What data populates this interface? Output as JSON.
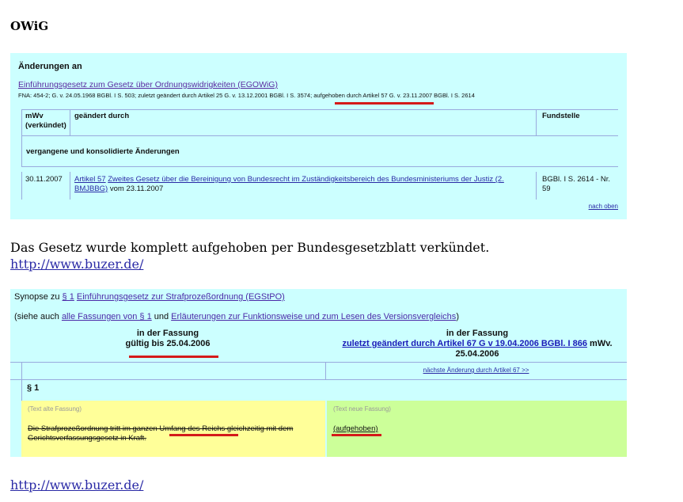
{
  "heading": "OWiG",
  "panel1": {
    "header": "Änderungen an",
    "law_link": "Einführungsgesetz zum Gesetz über Ordnungswidrigkeiten (EGOWiG)",
    "fna_part1": "FNA: 454-2; G. v. 24.05.1968 BGBl. I S. 503; zuletzt geändert durch Artikel 25 G. v. 13.12.2001 BGBl. I S. 3574; ",
    "fna_part2": "aufgehoben durch Artikel 57 G. v. 23.11.2007 BGBl. I S. 2614",
    "col_mwv_1": "mWv",
    "col_mwv_2": "(verkündet)",
    "col_changed_by": "geändert durch",
    "col_fundstelle": "Fundstelle",
    "section": "vergangene und konsolidierte Änderungen",
    "row": {
      "date": "30.11.2007",
      "article": "Artikel 57",
      "law_title_1": "Zweites Gesetz über die Bereinigung von Bundesrecht im Zuständigkeitsbereich des Bundesministeriums der Justiz (2.",
      "law_title_2": "BMJBBG)",
      "law_date": " vom 23.11.2007",
      "fundstelle_1": "BGBl. I S. 2614 - Nr.",
      "fundstelle_2": "59"
    },
    "nach_oben": "nach oben"
  },
  "paragraph": "Das Gesetz wurde komplett aufgehoben per Bundesgesetzblatt verkündet.",
  "url1": "http://www.buzer.de/",
  "panel2": {
    "synopse_prefix": "Synopse zu ",
    "synopse_section": "§ 1",
    "synopse_law": "Einführungsgesetz zur Strafprozeßordnung (EGStPO)",
    "siehe_prefix": "(siehe auch ",
    "siehe_link1": "alle Fassungen von § 1",
    "siehe_mid": " und ",
    "siehe_link2": "Erläuterungen zur Funktionsweise und zum Lesen des Versionsvergleichs",
    "siehe_suffix": ")",
    "left_line1": "in der Fassung",
    "left_line2": "gültig bis 25.04.2006",
    "right_line1": "in der Fassung",
    "right_link": "zuletzt geändert durch Artikel 67 G v 19.04.2006 BGBl. I 866",
    "right_suffix": " mWv.",
    "right_line3": "25.04.2006",
    "next_change": "nächste Änderung durch Artikel 67 >>",
    "section_no": "§ 1",
    "old_label": "(Text alte Fassung)",
    "new_label": "(Text neue Fassung)",
    "old_text": "Die Strafprozeßordnung tritt im ganzen Umfang des Reichs gleichzeitig mit dem Gerichtsverfassungsgesetz in Kraft.",
    "new_text": "(aufgehoben)"
  },
  "url2": "http://www.buzer.de/",
  "colors": {
    "panel_bg": "#ccffff",
    "old_bg": "#ffff99",
    "new_bg": "#ccff99",
    "highlight_red": "#d41a1a"
  }
}
